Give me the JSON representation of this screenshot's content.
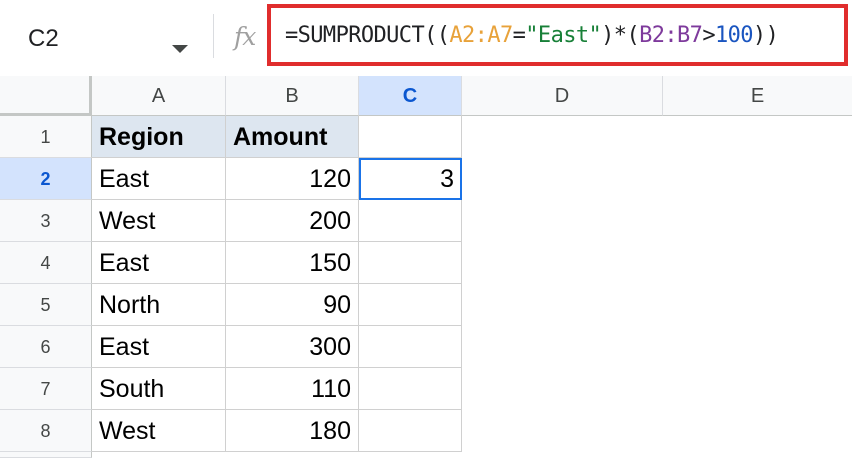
{
  "name_box": {
    "value": "C2"
  },
  "formula_bar": {
    "fx_icon": "fx",
    "parts": [
      "=SUMPRODUCT((",
      "A2:A7",
      "=",
      "\"East\"",
      ")*(",
      "B2:B7",
      ">",
      "100",
      "))"
    ]
  },
  "columns": [
    "A",
    "B",
    "C",
    "D",
    "E"
  ],
  "selected_column": "C",
  "rows": [
    "1",
    "2",
    "3",
    "4",
    "5",
    "6",
    "7",
    "8"
  ],
  "selected_row": "2",
  "cells": {
    "A1": "Region",
    "B1": "Amount",
    "A2": "East",
    "B2": "120",
    "C2": "3",
    "A3": "West",
    "B3": "200",
    "A4": "East",
    "B4": "150",
    "A5": "North",
    "B5": "90",
    "A6": "East",
    "B6": "300",
    "A7": "South",
    "B7": "110",
    "A8": "West",
    "B8": "180"
  },
  "colors": {
    "highlight_border": "#e02d2d",
    "selection_blue": "#1a73e8",
    "header_fill": "#dde6f0"
  }
}
